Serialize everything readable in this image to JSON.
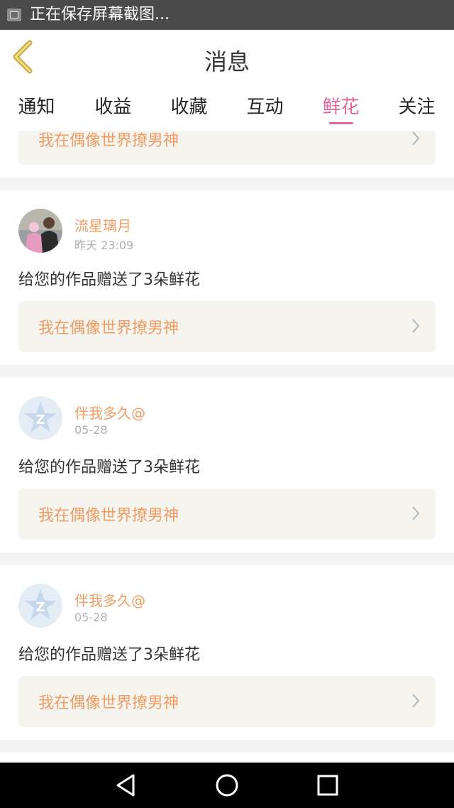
{
  "status_bar": {
    "text": "正在保存屏幕截图..."
  },
  "header": {
    "title": "消息"
  },
  "tabs": [
    {
      "label": "通知"
    },
    {
      "label": "收益"
    },
    {
      "label": "收藏"
    },
    {
      "label": "互动"
    },
    {
      "label": "鲜花",
      "active": true
    },
    {
      "label": "关注"
    }
  ],
  "cards": [
    {
      "work_title": "我在偶像世界撩男神"
    },
    {
      "user": "流星璃月",
      "time": "昨天 23:09",
      "message": "给您的作品赠送了3朵鲜花",
      "work_title": "我在偶像世界撩男神",
      "avatar": "photo"
    },
    {
      "user": "伴我多久@",
      "time": "05-28",
      "message": "给您的作品赠送了3朵鲜花",
      "work_title": "我在偶像世界撩男神",
      "avatar": "default-qq"
    },
    {
      "user": "伴我多久@",
      "time": "05-28",
      "message": "给您的作品赠送了3朵鲜花",
      "work_title": "我在偶像世界撩男神",
      "avatar": "default-qq"
    }
  ],
  "colors": {
    "accent": "#e0679b",
    "name": "#f29c63",
    "work_bg": "#f5f4ee"
  },
  "icons": {
    "back": "chevron-left-icon",
    "chevron": "chevron-right-icon",
    "nav_back": "triangle-back-icon",
    "nav_home": "circle-home-icon",
    "nav_recent": "square-recent-icon"
  }
}
